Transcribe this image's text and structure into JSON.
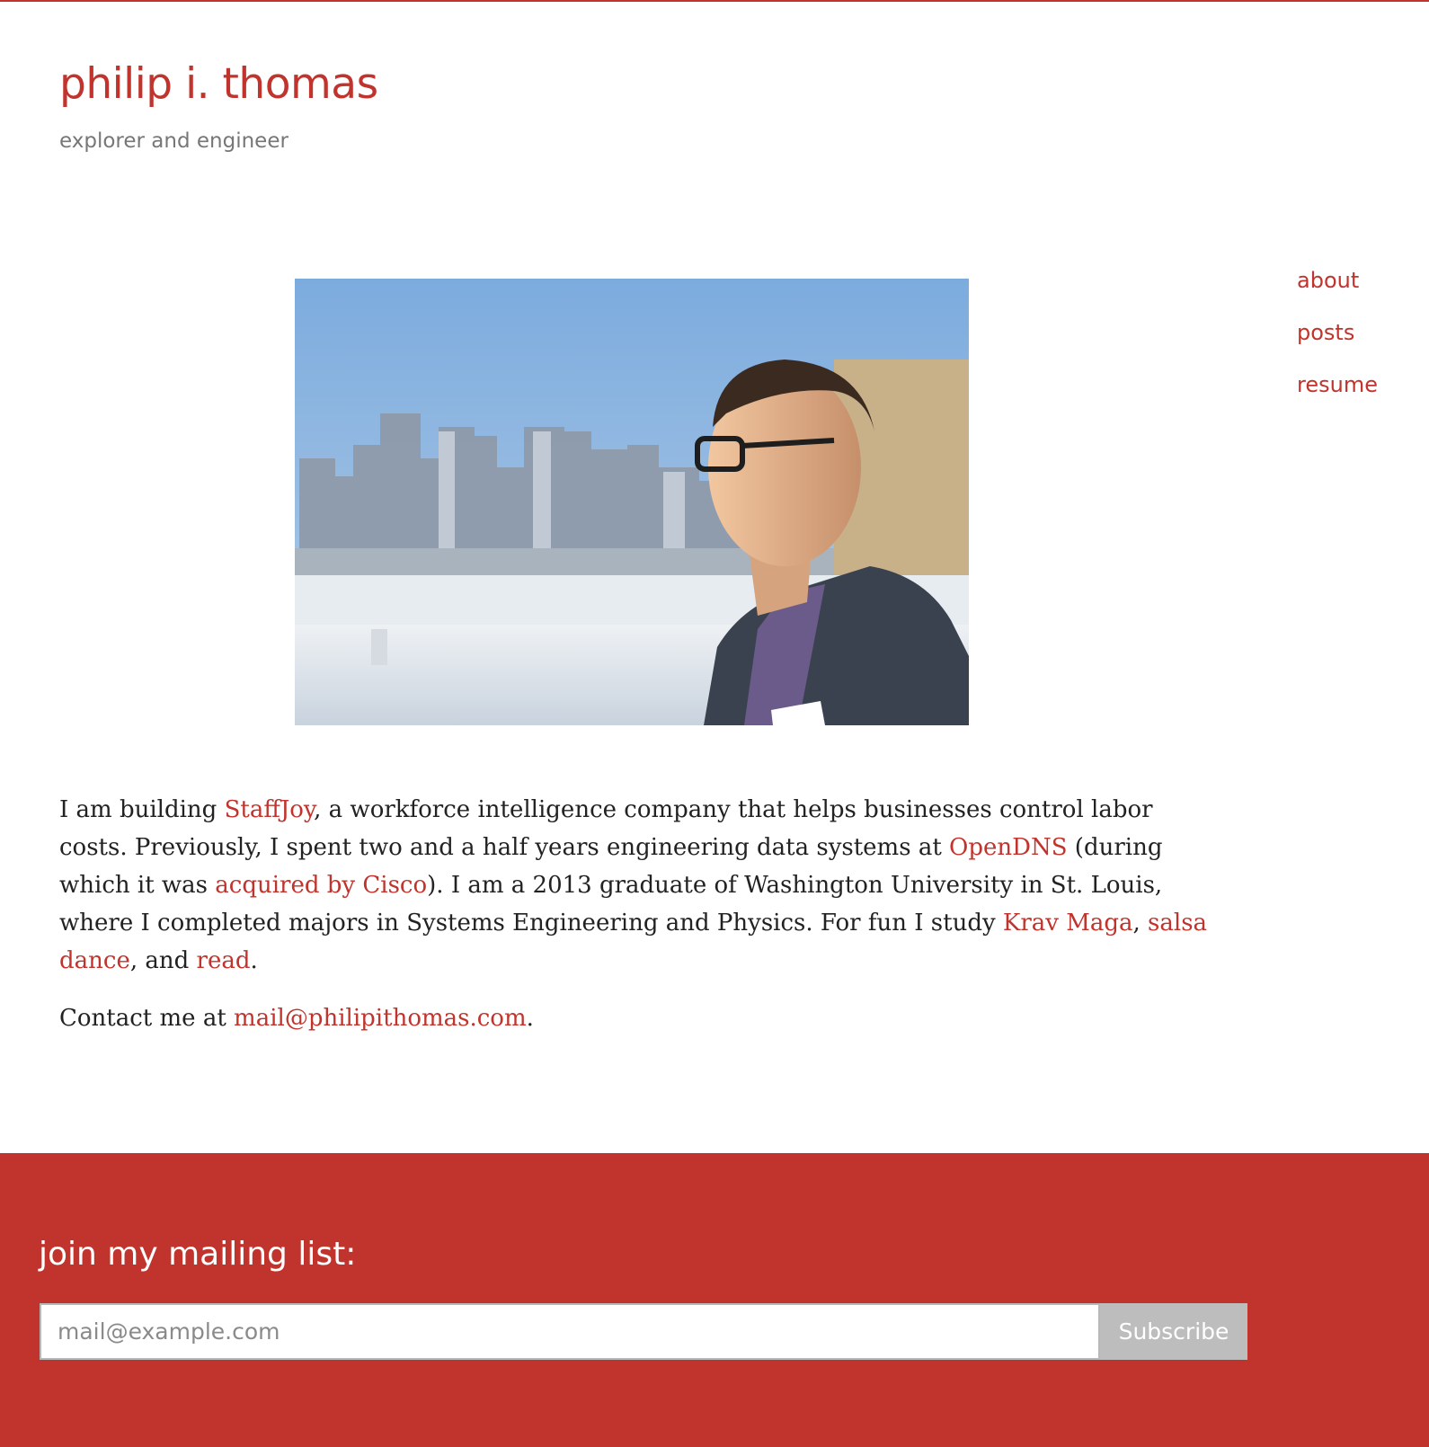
{
  "colors": {
    "accent": "#c0342d",
    "tagline": "#777777",
    "body_text": "#222222",
    "button_bg": "#bdbdbd"
  },
  "header": {
    "title": "philip i. thomas",
    "tagline": "explorer and engineer"
  },
  "nav": {
    "items": [
      {
        "label": "about"
      },
      {
        "label": "posts"
      },
      {
        "label": "resume"
      }
    ]
  },
  "bio": {
    "p1_text_1": "I am building ",
    "link_staffjoy": "StaffJoy",
    "p1_text_2": ", a workforce intelligence company that helps businesses control labor costs. Previously, I spent two and a half years engineering data systems at ",
    "link_opendns": "OpenDNS",
    "p1_text_3": " (during which it was ",
    "link_cisco": "acquired by Cisco",
    "p1_text_4": "). I am a 2013 graduate of Washington University in St. Louis, where I completed majors in Systems Engineering and Physics. For fun I study ",
    "link_krav": "Krav Maga",
    "p1_text_5": ", ",
    "link_salsa": "salsa dance",
    "p1_text_6": ", and ",
    "link_read": "read",
    "p1_text_7": ".",
    "p2_text_1": "Contact me at ",
    "link_email": "mail@philipithomas.com",
    "p2_text_2": "."
  },
  "footer": {
    "heading": "join my mailing list:",
    "email_placeholder": "mail@example.com",
    "subscribe_label": "Subscribe"
  }
}
